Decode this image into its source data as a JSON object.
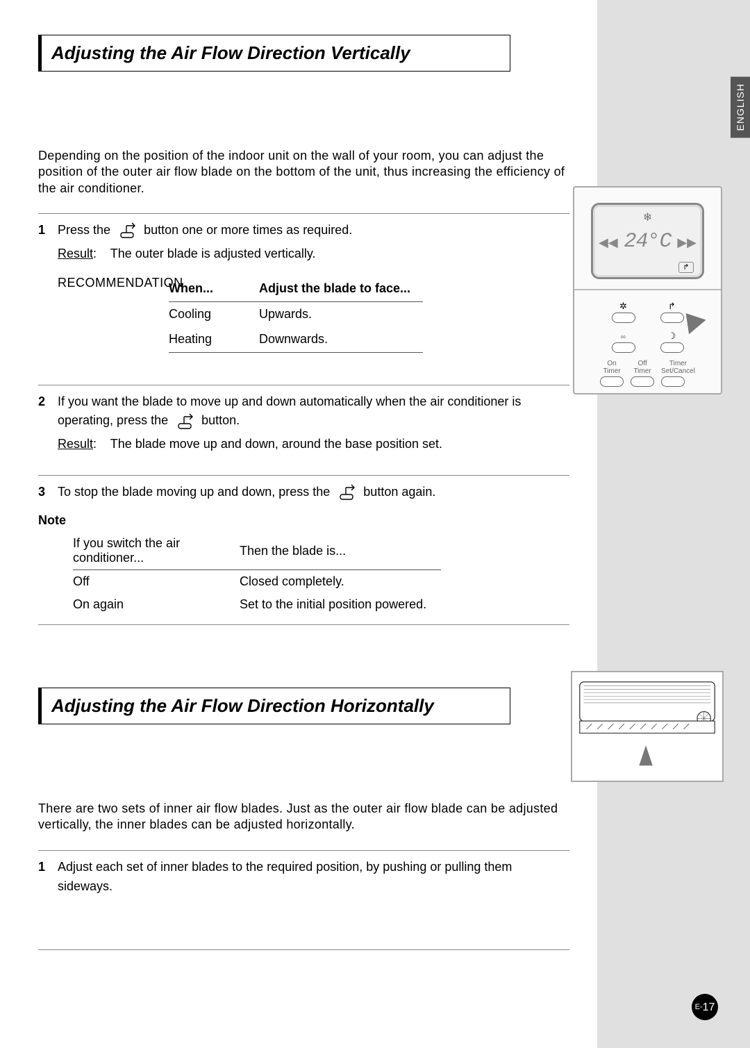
{
  "language_tab": "ENGLISH",
  "section1": {
    "title": "Adjusting the Air Flow Direction Vertically",
    "intro": "Depending on the position of the indoor unit on the wall of your room, you can adjust the position of the outer air flow blade on the bottom of the unit, thus increasing the efficiency of the air conditioner.",
    "step1_a": "Press the",
    "step1_b": "button one or more times as required.",
    "result_label": "Result",
    "step1_result": "The outer blade is adjusted vertically.",
    "rec_label": "RECOMMENDATION",
    "rec_head_when": "When...",
    "rec_head_adjust": "Adjust the blade to face...",
    "rec_rows": [
      {
        "when": "Cooling",
        "adjust": "Upwards."
      },
      {
        "when": "Heating",
        "adjust": "Downwards."
      }
    ],
    "step2_a": "If you want the blade to move up and down automatically when the air conditioner is operating, press the",
    "step2_b": "button.",
    "step2_result": "The blade move up and down, around the base position set.",
    "step3_a": "To stop the blade moving up and down, press the",
    "step3_b": "button again.",
    "note_label": "Note",
    "note_head_if": "If you switch the air conditioner...",
    "note_head_then": "Then the blade is...",
    "note_rows": [
      {
        "if": "Off",
        "then": "Closed completely."
      },
      {
        "if": "On again",
        "then": "Set to the initial position powered."
      }
    ]
  },
  "section2": {
    "title": "Adjusting the Air Flow Direction Horizontally",
    "intro": "There are two sets of inner air flow blades. Just as the outer air flow blade can be adjusted vertically, the inner blades can be adjusted horizontally.",
    "step1": "Adjust each set of inner blades to the required position, by pushing or pulling them sideways."
  },
  "remote": {
    "temp_display": "24°C",
    "timer_labels": [
      "On\nTimer",
      "Off\nTimer",
      "Timer\nSet/Cancel"
    ]
  },
  "page_prefix": "E-",
  "page_number": "17"
}
